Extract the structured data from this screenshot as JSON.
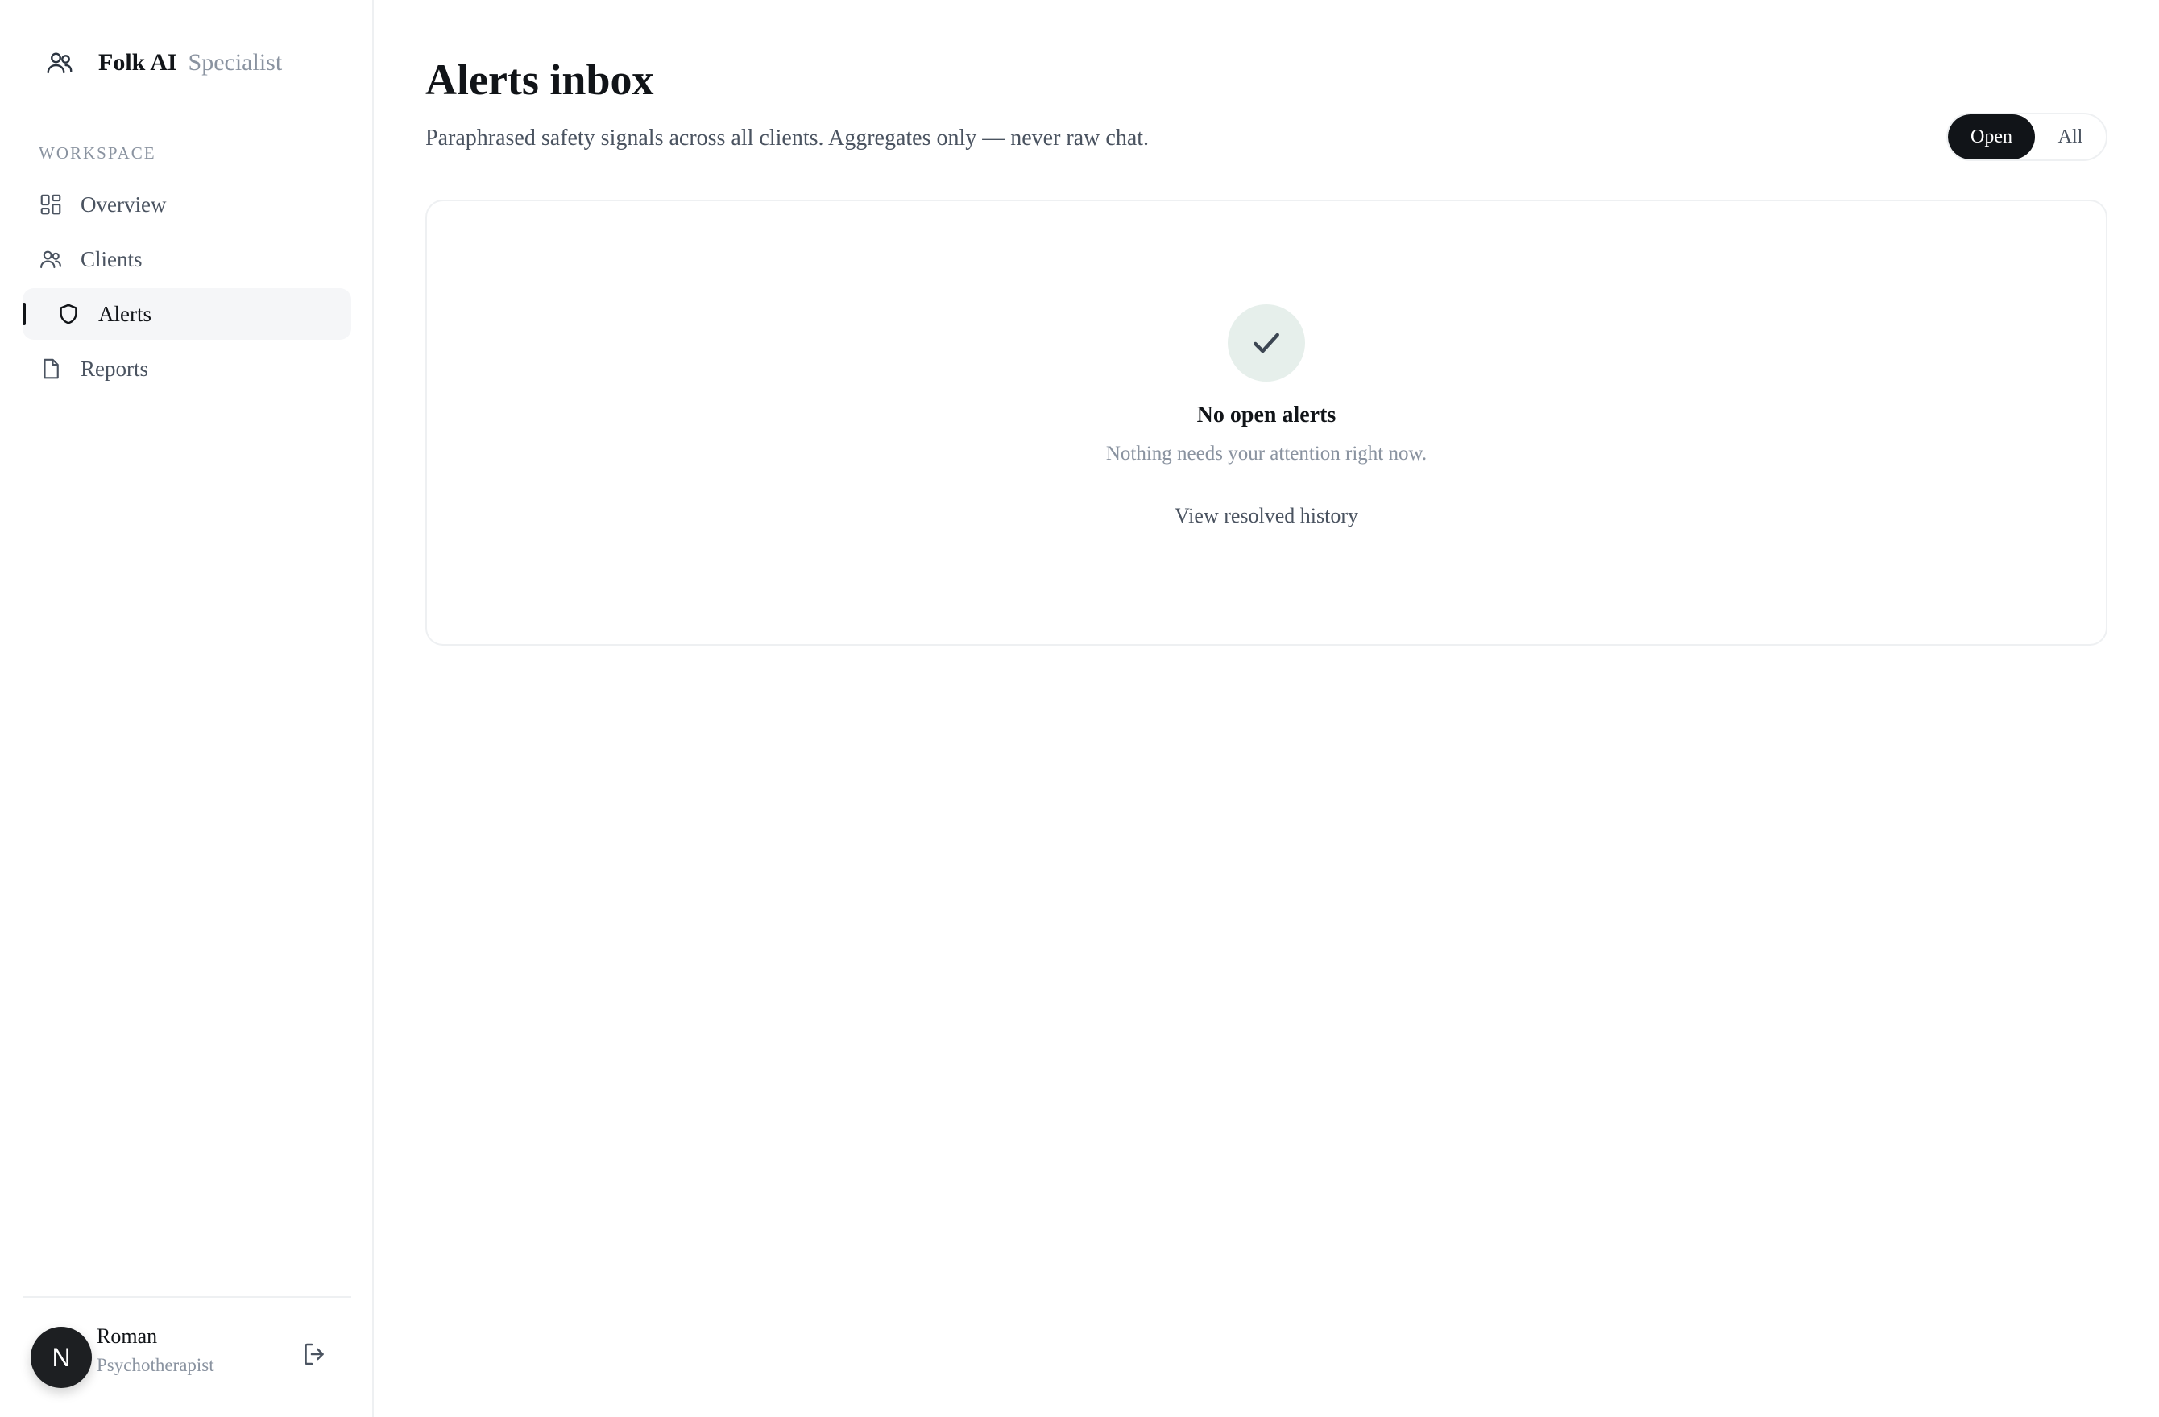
{
  "brand": {
    "name": "Folk AI",
    "role": "Specialist",
    "icon": "users-icon"
  },
  "sidebar": {
    "section_label": "WORKSPACE",
    "items": [
      {
        "label": "Overview",
        "icon": "grid-icon"
      },
      {
        "label": "Clients",
        "icon": "users-icon"
      },
      {
        "label": "Alerts",
        "icon": "shield-icon",
        "active": true
      },
      {
        "label": "Reports",
        "icon": "file-icon"
      }
    ]
  },
  "user": {
    "initial": "N",
    "name": "Roman",
    "role": "Psychotherapist",
    "logout_icon": "logout-icon"
  },
  "header": {
    "title": "Alerts inbox",
    "subtitle": "Paraphrased safety signals across all clients. Aggregates only — never raw chat."
  },
  "filter": {
    "options": [
      "Open",
      "All"
    ],
    "selected": "Open"
  },
  "empty_state": {
    "icon": "check-icon",
    "title": "No open alerts",
    "subtitle": "Nothing needs your attention right now.",
    "link": "View resolved history"
  },
  "colors": {
    "accent": "#111418",
    "muted": "#8a93a0",
    "success_bg": "#e6efeb"
  }
}
